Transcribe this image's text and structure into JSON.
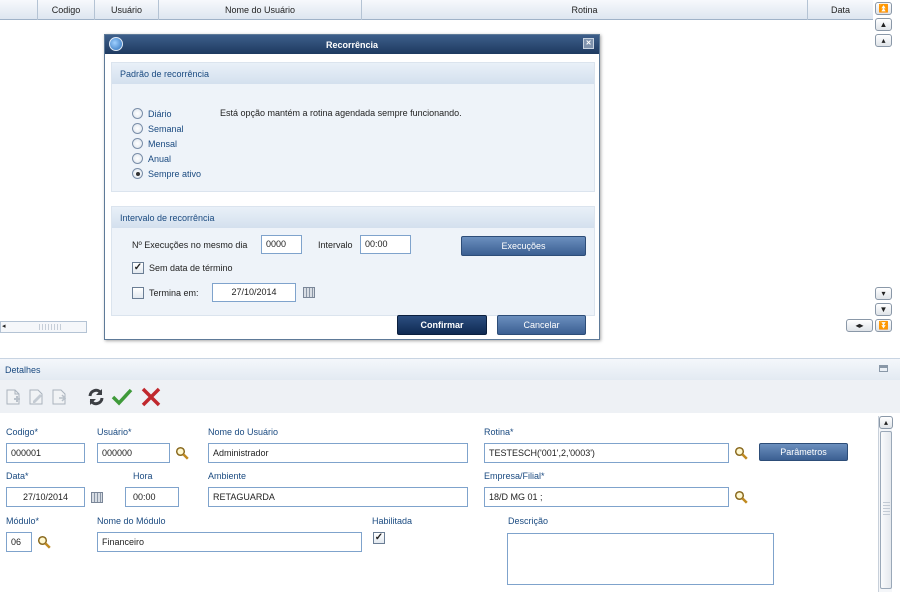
{
  "grid": {
    "columns": [
      "Codigo",
      "Usuário",
      "Nome do Usuário",
      "Rotina",
      "Data"
    ]
  },
  "modal": {
    "title": "Recorrência",
    "pattern_section": "Padrão de recorrência",
    "options": [
      "Diário",
      "Semanal",
      "Mensal",
      "Anual",
      "Sempre ativo"
    ],
    "selected_option": "Sempre ativo",
    "description": "Está opção mantém a rotina agendada sempre funcionando.",
    "interval_section": "Intervalo de recorrência",
    "exec_same_day_label": "Nº Execuções no mesmo dia",
    "exec_same_day_value": "0000",
    "interval_label": "Intervalo",
    "interval_value": "00:00",
    "execucoes_button": "Execuções",
    "no_end_date_label": "Sem data de término",
    "no_end_date_checked": true,
    "ends_on_label": "Termina em:",
    "ends_on_value": "27/10/2014",
    "ends_on_checked": false,
    "confirm_button": "Confirmar",
    "cancel_button": "Cancelar"
  },
  "details": {
    "title": "Detalhes",
    "codigo_label": "Codigo*",
    "codigo_value": "000001",
    "usuario_label": "Usuário*",
    "usuario_value": "000000",
    "nome_usuario_label": "Nome do Usuário",
    "nome_usuario_value": "Administrador",
    "rotina_label": "Rotina*",
    "rotina_value": "TESTESCH('001',2,'0003')",
    "parametros_button": "Parâmetros",
    "data_label": "Data*",
    "data_value": "27/10/2014",
    "hora_label": "Hora",
    "hora_value": "00:00",
    "ambiente_label": "Ambiente",
    "ambiente_value": "RETAGUARDA",
    "empresa_label": "Empresa/Filial*",
    "empresa_value": "18/D MG 01 ;",
    "modulo_label": "Módulo*",
    "modulo_value": "06",
    "nome_modulo_label": "Nome do Módulo",
    "nome_modulo_value": "Financeiro",
    "habilitada_label": "Habilitada",
    "habilitada_checked": true,
    "descricao_label": "Descrição",
    "descricao_value": ""
  },
  "colors": {
    "accent": "#1a4a80",
    "title_bar": "#1e3a60",
    "input_border": "#7fa3cc"
  },
  "icons": [
    "globe-icon",
    "close-icon",
    "search-icon",
    "calendar-icon",
    "refresh-icon",
    "check-icon",
    "delete-icon"
  ]
}
